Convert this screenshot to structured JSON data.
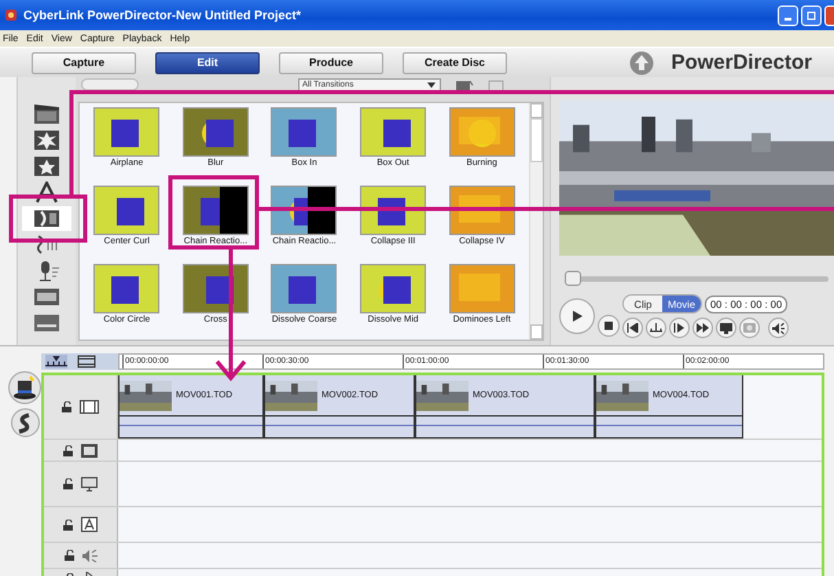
{
  "window": {
    "title": "CyberLink PowerDirector-New Untitled Project*"
  },
  "menu": [
    "File",
    "Edit",
    "View",
    "Capture",
    "Playback",
    "Help"
  ],
  "modes": [
    {
      "label": "Capture",
      "selected": false
    },
    {
      "label": "Edit",
      "selected": true
    },
    {
      "label": "Produce",
      "selected": false
    },
    {
      "label": "Create Disc",
      "selected": false
    }
  ],
  "brand": "PowerDirector",
  "library": {
    "filter": "All Transitions",
    "rooms": [
      {
        "kind": "media",
        "selected": false
      },
      {
        "kind": "effect",
        "selected": false
      },
      {
        "kind": "pip",
        "selected": false
      },
      {
        "kind": "title",
        "selected": false
      },
      {
        "kind": "transition",
        "selected": true
      },
      {
        "kind": "audio",
        "selected": false
      },
      {
        "kind": "voice",
        "selected": false
      },
      {
        "kind": "chapter",
        "selected": false
      },
      {
        "kind": "subtitle",
        "selected": false
      }
    ],
    "transitions": [
      {
        "label": "Airplane"
      },
      {
        "label": "Blur"
      },
      {
        "label": "Box In"
      },
      {
        "label": "Box Out"
      },
      {
        "label": "Burning"
      },
      {
        "label": "Center Curl"
      },
      {
        "label": "Chain Reactio..."
      },
      {
        "label": "Chain Reactio..."
      },
      {
        "label": "Collapse III"
      },
      {
        "label": "Collapse IV"
      },
      {
        "label": "Color Circle"
      },
      {
        "label": "Cross"
      },
      {
        "label": "Dissolve Coarse"
      },
      {
        "label": "Dissolve Mid"
      },
      {
        "label": "Dominoes Left"
      }
    ]
  },
  "preview": {
    "kind": "picture",
    "level": 0,
    "modes": [
      {
        "label": "Clip",
        "selected": false
      },
      {
        "label": "Movie",
        "selected": true
      }
    ],
    "timecode": "00 : 00 : 00 : 00"
  },
  "timeline": {
    "ruler": [
      "00:00:00:00",
      "00:00:30:00",
      "00:01:00:00",
      "00:01:30:00",
      "00:02:00:00"
    ],
    "tracks": [
      {
        "kind": "video",
        "clips": [
          "MOV001.TOD",
          "MOV002.TOD",
          "MOV003.TOD",
          "MOV004.TOD"
        ]
      },
      {
        "kind": "effect"
      },
      {
        "kind": "pip"
      },
      {
        "kind": "title"
      },
      {
        "kind": "voice"
      },
      {
        "kind": "music"
      }
    ]
  }
}
